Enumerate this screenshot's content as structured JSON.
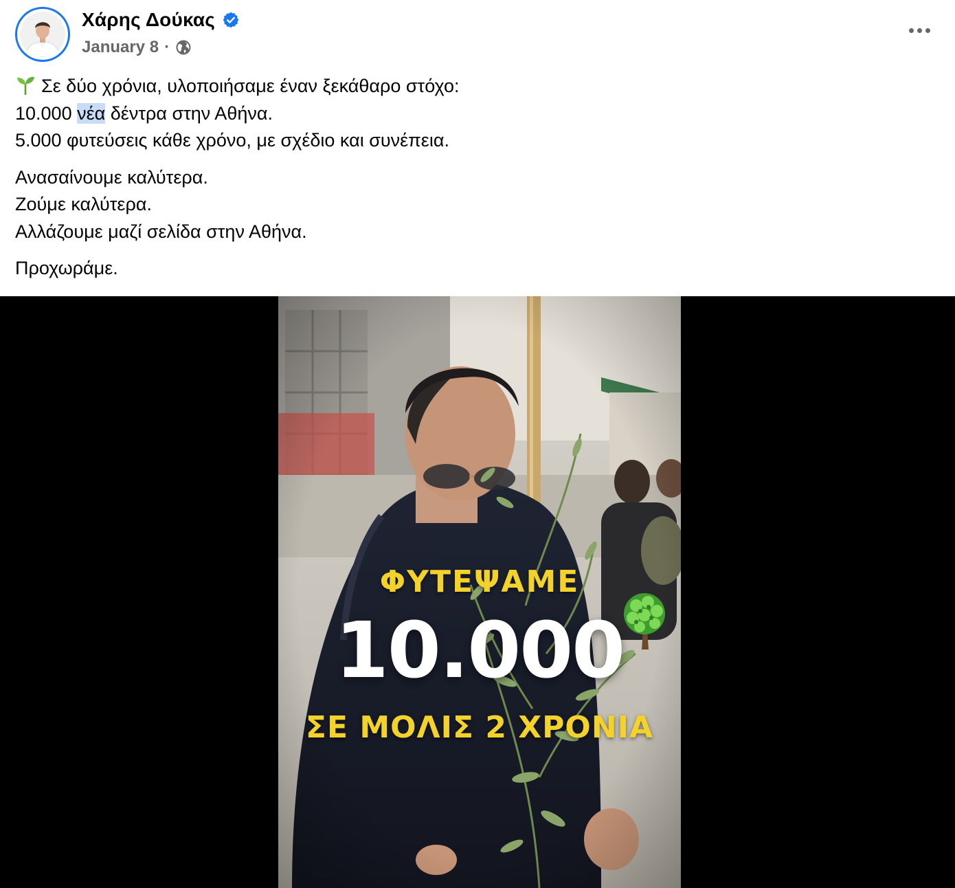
{
  "post": {
    "author": "Χάρης Δούκας",
    "verified": true,
    "date": "January 8",
    "separator": "·",
    "audience_icon": "globe-icon",
    "more_icon": "more-dots-icon"
  },
  "body": {
    "p1": {
      "emoji_icon": "seedling-icon",
      "line1": "Σε δύο χρόνια, υλοποιήσαμε έναν ξεκάθαρο στόχο:",
      "line2_prefix": "10.000 ",
      "line2_highlight": "νέα",
      "line2_suffix": " δέντρα στην Αθήνα.",
      "line3": "5.000 φυτεύσεις κάθε χρόνο, με σχέδιο και συνέπεια."
    },
    "p2": {
      "line1": "Ανασαίνουμε καλύτερα.",
      "line2": "Ζούμε καλύτερα.",
      "line3": "Αλλάζουμε μαζί σελίδα στην Αθήνα."
    },
    "p3": {
      "line1": "Προχωράμε."
    }
  },
  "video": {
    "overlay_top": "ΦΥΤΕΨΑΜΕ",
    "overlay_big": "10.000",
    "overlay_bottom": "ΣΕ ΜΟΛΙΣ 2 ΧΡΟΝΙΑ",
    "overlay_icon": "tree-icon",
    "colors": {
      "yellow": "#f3d32b",
      "white": "#ffffff",
      "background": "#000000"
    }
  },
  "colors": {
    "accent": "#1877f2",
    "text": "#050505",
    "secondary": "#65676b",
    "highlight": "#c7dcf6"
  }
}
